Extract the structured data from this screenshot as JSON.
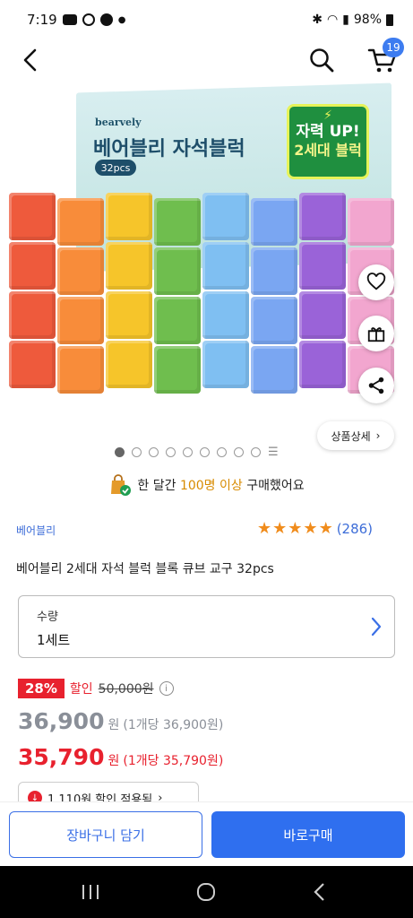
{
  "status": {
    "time": "7:19",
    "battery": "98%"
  },
  "cart": {
    "count": "19"
  },
  "hero": {
    "box_brand": "bearvely",
    "box_title": "베어블리 자석블럭",
    "box_pcs": "32pcs",
    "badge_line1": "자력 UP!",
    "badge_line2": "2세대 블럭",
    "cube_colors": [
      "#ee5a3c",
      "#f88c3a",
      "#f6c52a",
      "#6fbe4e",
      "#7fbff2",
      "#7aa6f2",
      "#9a63d8",
      "#f2a6cf"
    ],
    "detail_label": "상품상세"
  },
  "carousel": {
    "total": 9,
    "current": 1
  },
  "buyers": {
    "prefix": "한 달간 ",
    "highlight": "100명 이상",
    "suffix": " 구매했어요"
  },
  "product": {
    "brand": "베어블리",
    "rating_count": "(286)",
    "stars": 5,
    "title": "베어블리 2세대 자석 블럭 블록 큐브 교구 32pcs"
  },
  "quantity": {
    "label": "수량",
    "value": "1세트"
  },
  "pricing": {
    "discount_pct": "28%",
    "discount_label": "할인",
    "original": "50,000원",
    "price1": "36,900",
    "price1_won": "원",
    "price1_unit": "(1개당 36,900원)",
    "price2": "35,790",
    "price2_won": "원",
    "price2_unit": "(1개당 35,790원)",
    "coupon": "1,110원 할인 적용됨"
  },
  "actions": {
    "cart": "장바구니 담기",
    "buy": "바로구매"
  }
}
